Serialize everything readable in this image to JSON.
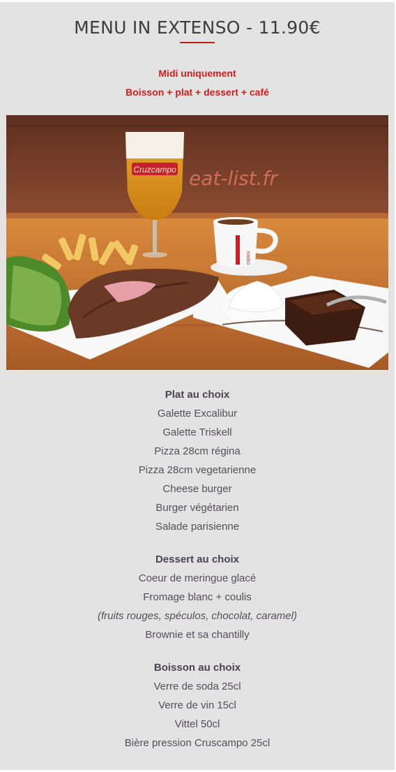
{
  "menu_title": "MENU IN EXTENSO - 11.90€",
  "subtitle_1": "Midi uniquement",
  "subtitle_2": "Boisson + plat + dessert + café",
  "photo": {
    "watermark": "eat-list.fr",
    "glass_brand": "Cruzcampo",
    "cup_brand": "KIMBO"
  },
  "sections": {
    "plat": {
      "title": "Plat au choix",
      "items": [
        "Galette Excalibur",
        "Galette Triskell",
        "Pizza 28cm régina",
        "Pizza 28cm vegetarienne",
        "Cheese burger",
        "Burger végétarien",
        "Salade parisienne"
      ]
    },
    "dessert": {
      "title": "Dessert au choix",
      "items": [
        "Coeur de meringue glacé",
        "Fromage blanc + coulis",
        "(fruits rouges, spéculos, chocolat, caramel)",
        "Brownie et sa chantilly"
      ]
    },
    "boisson": {
      "title": "Boisson au choix",
      "items": [
        "Verre de soda 25cl",
        "Verre de vin 15cl",
        "Vittel 50cl",
        "Bière pression Cruscampo 25cl"
      ]
    }
  },
  "colors": {
    "accent": "#d01f1b",
    "background": "#e3e3e3",
    "text": "#555058"
  }
}
